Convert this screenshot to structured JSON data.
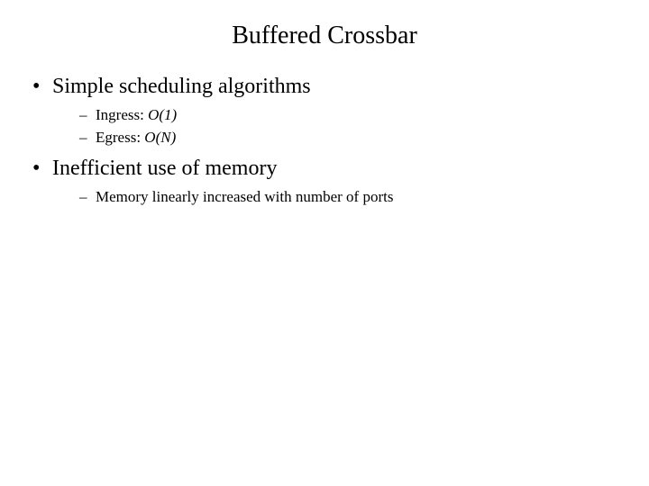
{
  "title": "Buffered Crossbar",
  "items": [
    {
      "text": "Simple scheduling algorithms",
      "sub": [
        {
          "label": "Ingress: ",
          "value": "O(1)"
        },
        {
          "label": "Egress: ",
          "value": "O(N)"
        }
      ]
    },
    {
      "text": "Inefficient use of memory",
      "sub": [
        {
          "label": "Memory linearly increased with number of ports",
          "value": ""
        }
      ]
    }
  ]
}
